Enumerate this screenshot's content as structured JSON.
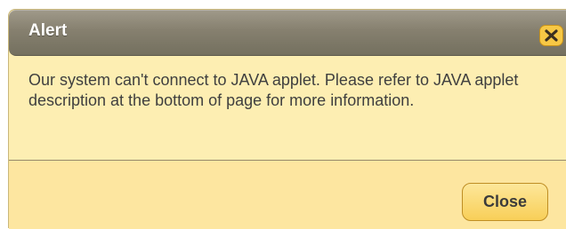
{
  "dialog": {
    "title": "Alert",
    "message": "Our system can't connect to JAVA applet. Please refer to JAVA applet description at the bottom of page for more information.",
    "close_button_label": "Close",
    "close_icon": "close-x-icon"
  },
  "colors": {
    "titlebar": "#86806f",
    "body_background": "#fdeeb2",
    "footer_background": "#fde6a0",
    "button_accent": "#f8cf58",
    "text": "#3f3f3f"
  }
}
